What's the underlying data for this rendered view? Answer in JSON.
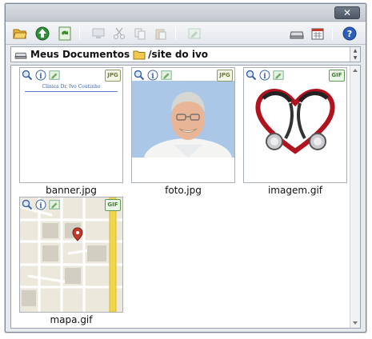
{
  "window": {
    "close_label": "✕"
  },
  "toolbar": {
    "buttons": [
      {
        "name": "open-folder",
        "icon": "folder-open-icon"
      },
      {
        "name": "go-up",
        "icon": "up-arrow-globe-icon"
      },
      {
        "name": "refresh",
        "icon": "refresh-icon"
      },
      {
        "name": "properties",
        "icon": "monitor-icon"
      },
      {
        "name": "cut",
        "icon": "scissors-icon"
      },
      {
        "name": "copy",
        "icon": "copy-icon"
      },
      {
        "name": "paste",
        "icon": "paste-icon"
      },
      {
        "name": "edit",
        "icon": "edit-image-icon"
      },
      {
        "name": "drive",
        "icon": "drive-icon"
      },
      {
        "name": "view",
        "icon": "calendar-view-icon"
      },
      {
        "name": "help",
        "icon": "help-icon"
      }
    ]
  },
  "path": {
    "root_label": "Meus Documentos",
    "folder_label": "/site do ivo"
  },
  "files": [
    {
      "name": "banner.jpg",
      "type": "JPG",
      "banner_text": "Clínica Dr. Ivo Coutinho"
    },
    {
      "name": "foto.jpg",
      "type": "JPG"
    },
    {
      "name": "imagem.gif",
      "type": "GIF"
    },
    {
      "name": "mapa.gif",
      "type": "GIF"
    }
  ],
  "colors": {
    "accent": "#3a62a8",
    "badge_jpg": "#6c7a40",
    "badge_gif": "#3f7d38",
    "map_road": "#f2d64a"
  }
}
